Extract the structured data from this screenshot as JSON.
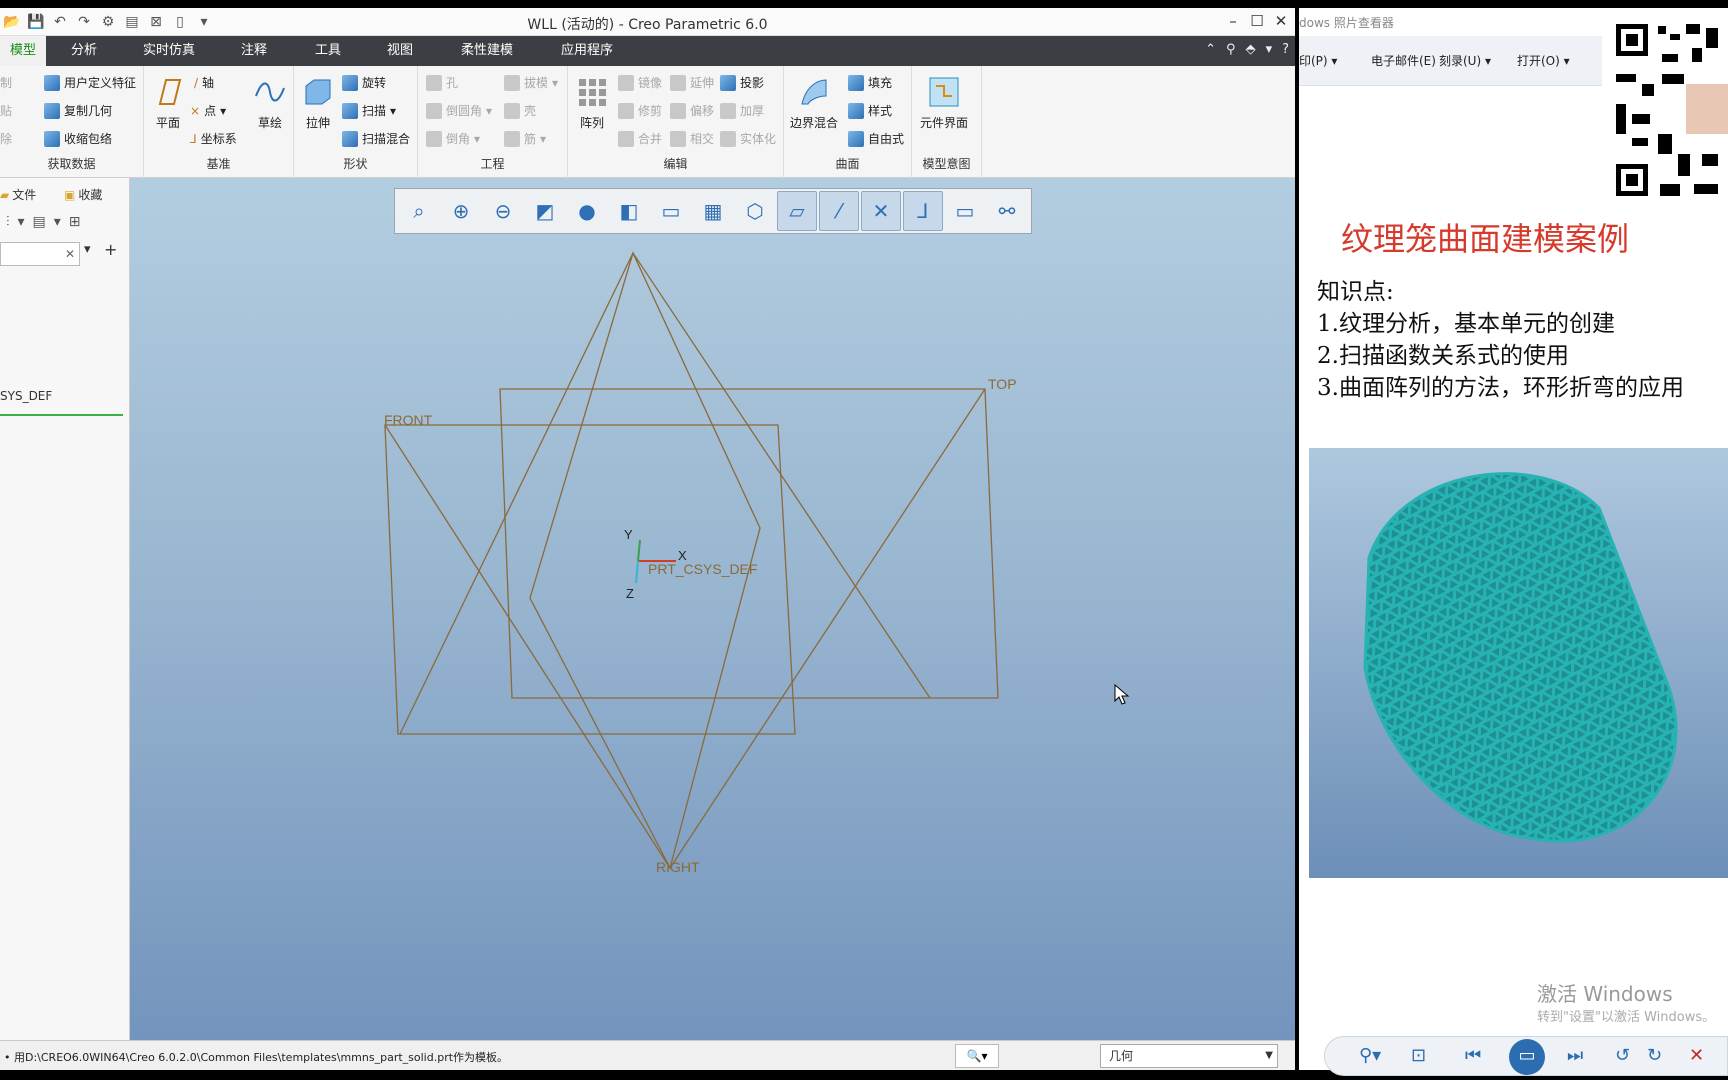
{
  "creo": {
    "title": "WLL (活动的) - Creo Parametric 6.0",
    "window_buttons": [
      "–",
      "☐",
      "✕"
    ],
    "tabs": [
      {
        "label": "模型",
        "active": true
      },
      {
        "label": "分析"
      },
      {
        "label": "实时仿真"
      },
      {
        "label": "注释"
      },
      {
        "label": "工具"
      },
      {
        "label": "视图"
      },
      {
        "label": "柔性建模"
      },
      {
        "label": "应用程序"
      }
    ],
    "ribbon": {
      "get_data": {
        "items": [
          "制",
          "贴",
          "除",
          "用户定义特征",
          "复制几何",
          "收缩包络"
        ],
        "group": "获取数据"
      },
      "datum": {
        "plane": "平面",
        "axis": "轴",
        "point": "点",
        "csys": "坐标系",
        "sketch": "草绘",
        "group": "基准"
      },
      "shapes": {
        "extrude": "拉伸",
        "revolve": "旋转",
        "sweep": "扫描",
        "swept_blend": "扫描混合",
        "group": "形状"
      },
      "engineering": {
        "hole": "孔",
        "round": "倒圆角",
        "chamfer": "倒角",
        "draft": "拔模",
        "shell": "壳",
        "rib": "筋",
        "group": "工程"
      },
      "editing": {
        "pattern": "阵列",
        "mirror": "镜像",
        "trim": "修剪",
        "merge": "合并",
        "extend": "延伸",
        "offset": "偏移",
        "intersect": "相交",
        "project": "投影",
        "thicken": "加厚",
        "solidify": "实体化",
        "group": "编辑"
      },
      "surfaces": {
        "boundary_blend": "边界混合",
        "fill": "填充",
        "style": "样式",
        "freestyle": "自由式",
        "group": "曲面"
      },
      "model_intent": {
        "component_interface": "元件界面",
        "group": "模型意图"
      }
    },
    "left_panel": {
      "tab1": "文件",
      "tab2": "收藏",
      "tree_item": "SYS_DEF"
    },
    "viewport": {
      "labels": {
        "front": "FRONT",
        "top": "TOP",
        "right": "RIGHT",
        "csys": "PRT_CSYS_DEF",
        "x": "X",
        "y": "Y",
        "z": "Z"
      },
      "datum_color": "#8a6a3a"
    },
    "status": {
      "message": "• 用D:\\CREO6.0WIN64\\Creo 6.0.2.0\\Common Files\\templates\\mmns_part_solid.prt作为模板。",
      "filter": "几何"
    }
  },
  "viewer": {
    "title": "dows 照片查看器",
    "menu": [
      "印(P) ▾",
      "电子邮件(E)",
      "刻录(U) ▾",
      "打开(O) ▾"
    ],
    "slide": {
      "title": "纹理笼曲面建模案例",
      "knowledge_heading": "知识点:",
      "points": [
        "1.纹理分析，基本单元的创建",
        "2.扫描函数关系式的使用",
        "3.曲面阵列的方法，环形折弯的应用"
      ],
      "model_color": "#27b3b3"
    },
    "watermark": {
      "line1": "激活 Windows",
      "line2": "转到\"设置\"以激活 Windows。"
    }
  }
}
